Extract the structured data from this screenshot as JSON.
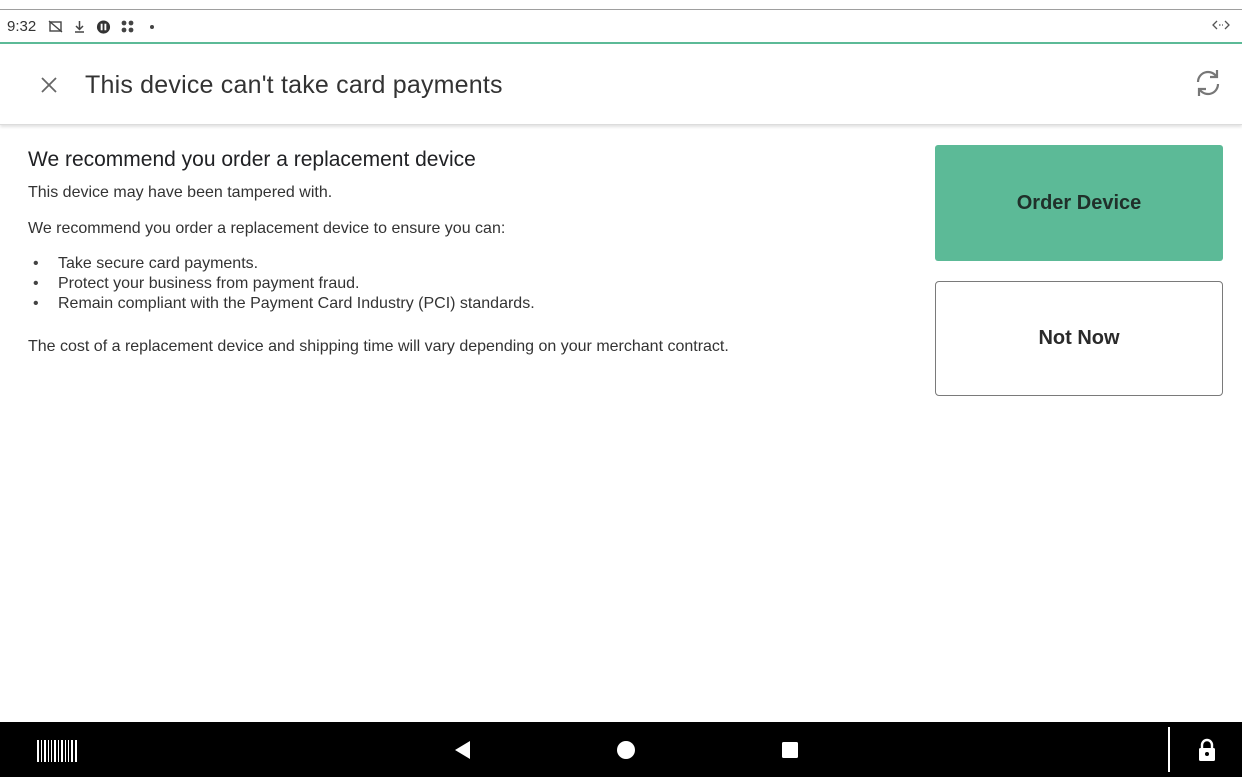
{
  "status_bar": {
    "time": "9:32",
    "icons": [
      "no-sim-icon",
      "download-icon",
      "notification-badge-icon",
      "apps-icon",
      "dot-icon"
    ],
    "right_icon": "swap-horizontal-icon"
  },
  "header": {
    "title": "This device can't take card payments",
    "close_icon": "close-icon",
    "refresh_icon": "refresh-icon"
  },
  "main": {
    "heading": "We recommend you order a replacement device",
    "paragraph1": "This device may have been tampered with.",
    "paragraph2": "We recommend you order a replacement device to ensure you can:",
    "bullets": [
      "Take secure card payments.",
      "Protect your business from payment fraud.",
      "Remain compliant with the Payment Card Industry (PCI) standards."
    ],
    "paragraph3": "The cost of a replacement device and shipping time will vary depending on your merchant contract."
  },
  "actions": {
    "order_label": "Order Device",
    "not_now_label": "Not Now"
  },
  "nav_bar": {
    "icons": [
      "barcode-icon",
      "back-icon",
      "home-icon",
      "recents-icon",
      "lock-icon"
    ]
  },
  "colors": {
    "accent": "#5cba97",
    "nav_background": "#000000",
    "text": "#333333"
  }
}
